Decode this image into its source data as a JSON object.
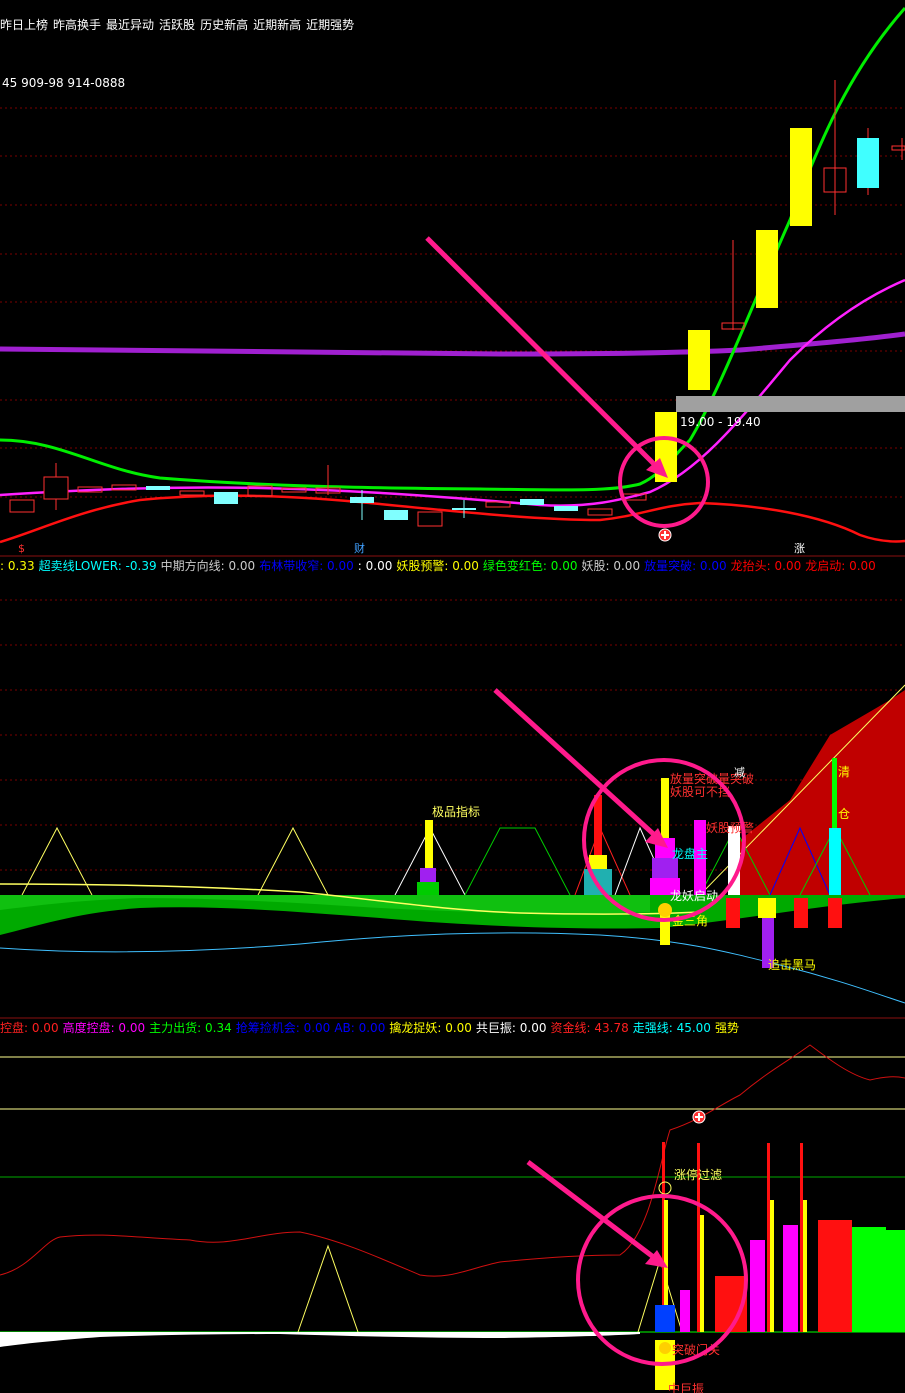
{
  "toolbar": {
    "tabs": [
      "昨日上榜",
      "昨高换手",
      "最近异动",
      "活跃股",
      "历史新高",
      "近期新高",
      "近期强势"
    ]
  },
  "info": {
    "phone_text": "45 909-98 914-0888"
  },
  "price_label": "19.00 - 19.40",
  "markers": {
    "cai": "财",
    "zhang": "涨",
    "dollar": "$"
  },
  "legend1": [
    {
      "label": "",
      "value": ": 0.33",
      "color": "#ffff00"
    },
    {
      "label": "超卖线LOWER:",
      "value": " -0.39",
      "color": "#00ffff"
    },
    {
      "label": "中期方向线:",
      "value": " 0.00",
      "color": "#cccccc"
    },
    {
      "label": "布林带收窄:",
      "value": " 0.00",
      "color": "#0000ff"
    },
    {
      "label": "",
      "value": ": 0.00",
      "color": "#ffffff"
    },
    {
      "label": "妖股预警:",
      "value": " 0.00",
      "color": "#ffff00"
    },
    {
      "label": "绿色变红色:",
      "value": " 0.00",
      "color": "#00ff00"
    },
    {
      "label": "妖股:",
      "value": " 0.00",
      "color": "#cccccc"
    },
    {
      "label": "放量突破:",
      "value": " 0.00",
      "color": "#0000ff"
    },
    {
      "label": "龙抬头:",
      "value": " 0.00",
      "color": "#ff0000"
    },
    {
      "label": "龙启动:",
      "value": " 0.00",
      "color": "#ff0000"
    }
  ],
  "legend2": [
    {
      "label": "控盘:",
      "value": " 0.00",
      "color": "#ff2020"
    },
    {
      "label": "高度控盘:",
      "value": " 0.00",
      "color": "#ff00ff"
    },
    {
      "label": "主力出货:",
      "value": " 0.34",
      "color": "#00ff00"
    },
    {
      "label": "抢筹捡机会:",
      "value": " 0.00",
      "color": "#0000ff"
    },
    {
      "label": "AB:",
      "value": " 0.00",
      "color": "#0000ff"
    },
    {
      "label": "擒龙捉妖:",
      "value": " 0.00",
      "color": "#ffff00"
    },
    {
      "label": "共巨振:",
      "value": " 0.00",
      "color": "#ffffff"
    },
    {
      "label": "资金线:",
      "value": " 43.78",
      "color": "#ff2020"
    },
    {
      "label": "走强线:",
      "value": " 45.00",
      "color": "#00ffff"
    },
    {
      "label": "强势",
      "value": "",
      "color": "#ffff00"
    }
  ],
  "panel2_labels": {
    "jipin": "极品指标",
    "fangliang": "放量突破量突破",
    "yaogu_bugang": "妖股可不挡",
    "jian": "减",
    "yaogu_yujing": "妖股预警",
    "qing": "清",
    "cang": "仓",
    "longpan": "龙盘主",
    "longyao": "龙妖启动",
    "sanjiao": "金三角",
    "heima": "追击黑马",
    "cang2": "仓"
  },
  "panel3_labels": {
    "zhangting": "涨停过滤",
    "tupo": "突破门关",
    "zhongju": "中巨振",
    "dollar": "$"
  },
  "colors": {
    "background": "#000000",
    "grid": "#7a0000",
    "accent_pink": "#ff1a8c",
    "candle_up": "#ffff00",
    "candle_down": "#00ffff"
  }
}
